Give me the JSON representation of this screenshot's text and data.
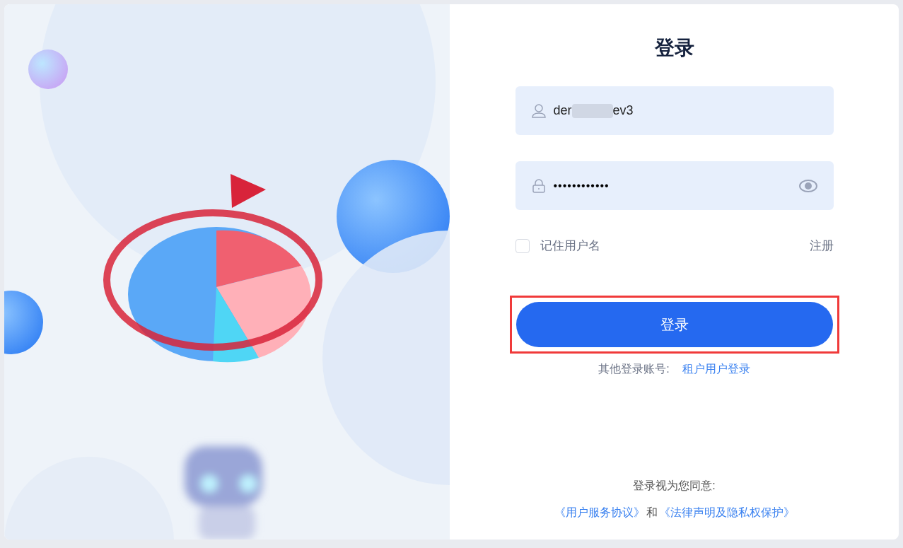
{
  "title": "登录",
  "username": {
    "value_start": "der",
    "value_end": "ev3",
    "redacted": true
  },
  "password": {
    "value": "••••••••••••"
  },
  "remember": {
    "label": "记住用户名",
    "checked": false
  },
  "register_link": "注册",
  "login_button": {
    "label": "登录",
    "highlighted": true
  },
  "other_login": {
    "label": "其他登录账号:",
    "link": "租户用户登录"
  },
  "agreement": {
    "intro": "登录视为您同意:",
    "links": [
      "《用户服务协议》",
      "《法律声明及隐私权保护》"
    ],
    "joiner": "和"
  }
}
